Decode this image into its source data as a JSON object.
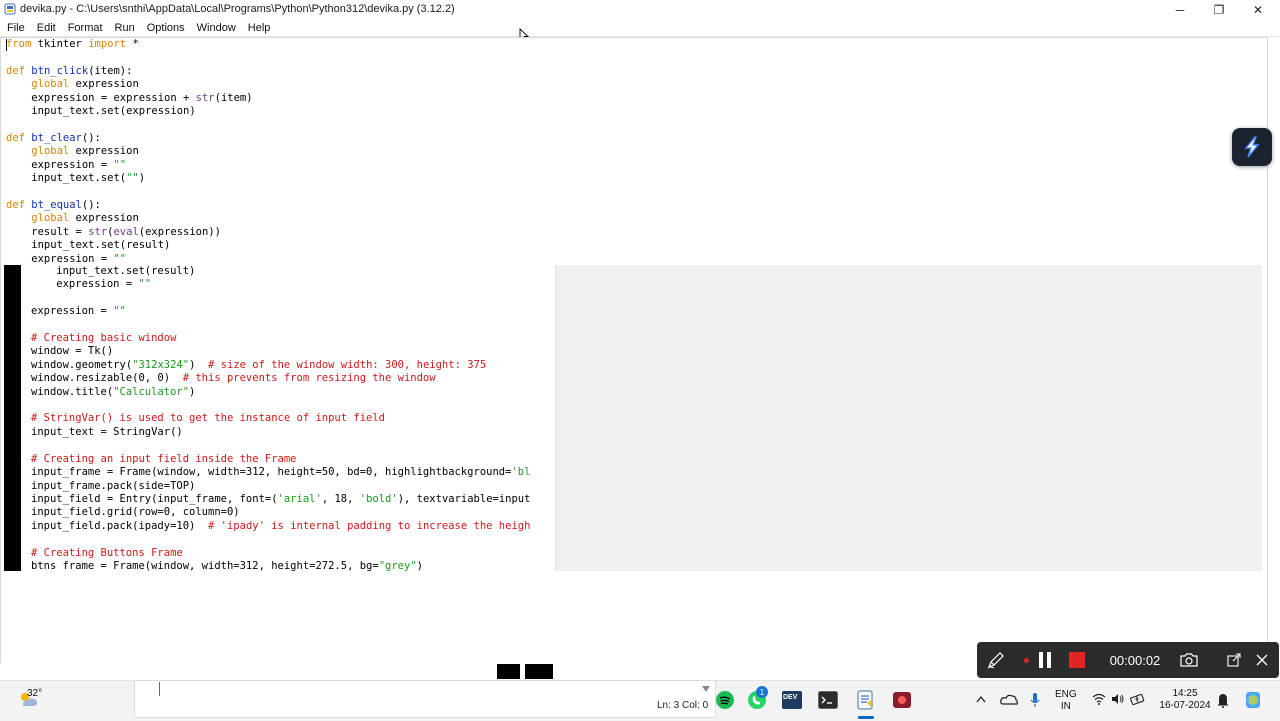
{
  "window": {
    "title": "devika.py - C:\\Users\\snthi\\AppData\\Local\\Programs\\Python\\Python312\\devika.py (3.12.2)",
    "minimize_label": "─",
    "maximize_label": "❐",
    "close_label": "✕"
  },
  "menu": [
    "File",
    "Edit",
    "Format",
    "Run",
    "Options",
    "Window",
    "Help"
  ],
  "status": {
    "position": "Ln: 3   Col: 0"
  },
  "recorder": {
    "timer": "00:00:02"
  },
  "taskbar": {
    "weather_temp": "32°",
    "whatsapp_badge": "1",
    "dev_label": "DEV",
    "lang_line1": "ENG",
    "lang_line2": "IN",
    "time": "14:25",
    "date": "16-07-2024"
  },
  "colors": {
    "keyword": "#d58500",
    "builtin": "#7a3a8c",
    "string": "#1a9a1a",
    "comment": "#d01818",
    "defname": "#1030b8",
    "recorder_bg": "#2b2b2b",
    "record_red": "#e02424"
  },
  "icons": [
    "app-icon",
    "minimize-icon",
    "maximize-icon",
    "close-icon",
    "pen-icon",
    "pause-icon",
    "stop-icon",
    "camera-icon",
    "expand-icon",
    "weather-icon",
    "spotify-icon",
    "whatsapp-icon",
    "terminal-icon",
    "idle-icon",
    "recorder-icon",
    "wifi-icon",
    "speaker-icon",
    "battery-icon",
    "copilot-icon",
    "onedrive-icon",
    "mic-icon",
    "chevron-up-icon",
    "cursor-icon"
  ]
}
